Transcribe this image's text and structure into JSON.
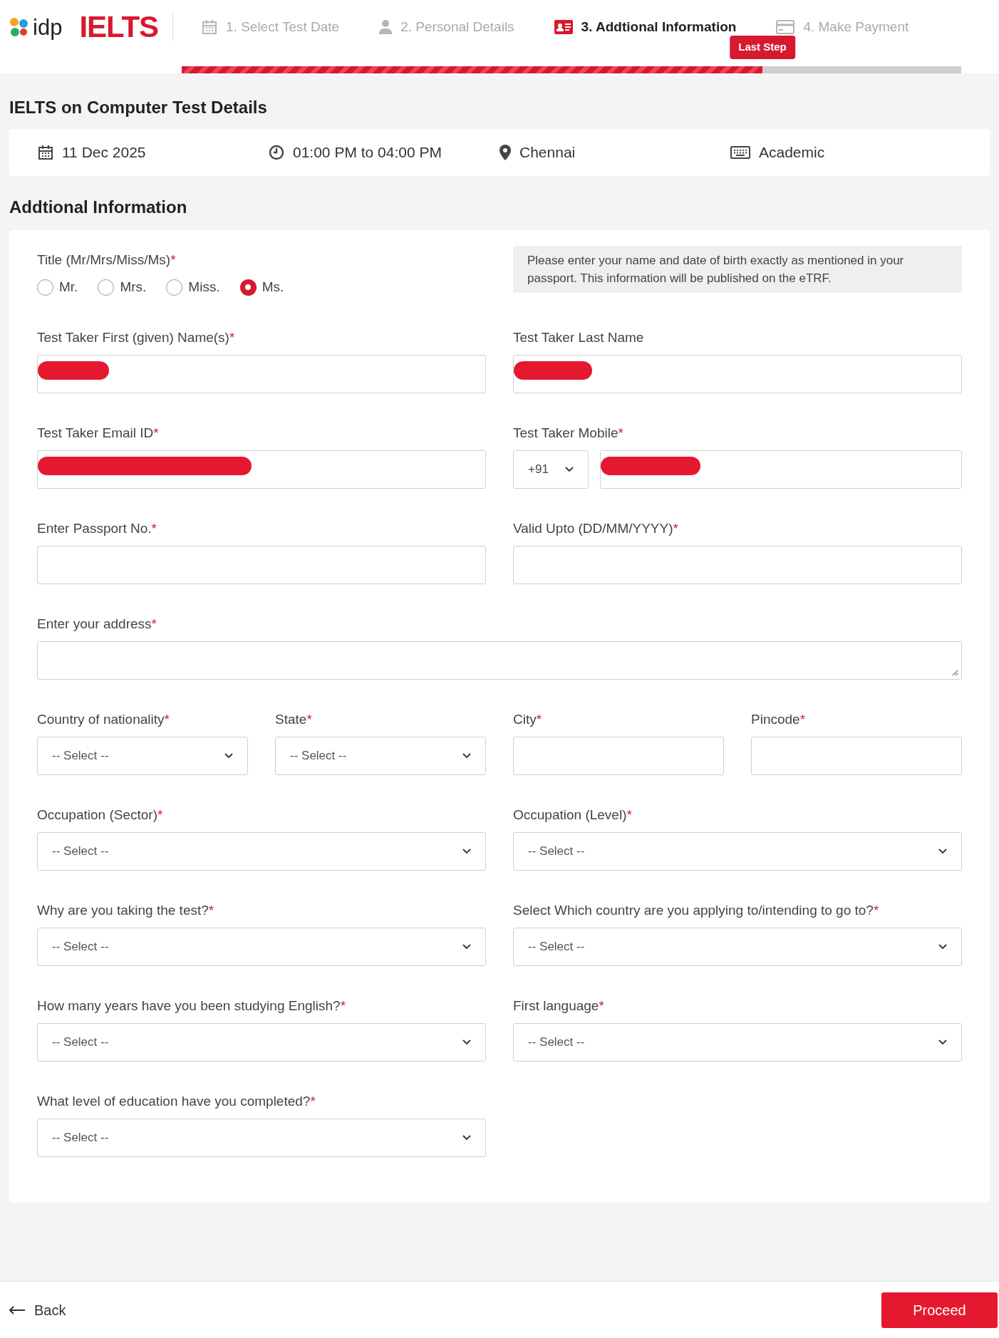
{
  "header": {
    "logo": "idp",
    "brand": "IELTS",
    "steps": [
      {
        "label": "1. Select Test Date",
        "kind": "calendar",
        "selected": false
      },
      {
        "label": "2. Personal Details",
        "kind": "person",
        "selected": false
      },
      {
        "label": "3. Addtional Information",
        "kind": "card",
        "selected": true
      },
      {
        "label": "4. Make Payment",
        "kind": "payment",
        "selected": false
      }
    ],
    "badge": "Last Step",
    "progress": {
      "level": 0.745
    }
  },
  "test_details": {
    "title": "IELTS on Computer Test Details",
    "items": [
      {
        "kind": "date",
        "text": "11 Dec 2025"
      },
      {
        "kind": "time",
        "text": "01:00 PM to 04:00 PM"
      },
      {
        "kind": "location",
        "text": "Chennai"
      },
      {
        "kind": "mode",
        "text": "Academic"
      }
    ]
  },
  "form": {
    "title": "Addtional Information",
    "title_field": {
      "label": "Title (Mr/Mrs/Miss/Ms)",
      "mark": "*",
      "options": [
        {
          "label": "Mr.",
          "selected": false
        },
        {
          "label": "Mrs.",
          "selected": false
        },
        {
          "label": "Miss.",
          "selected": false
        },
        {
          "label": "Ms.",
          "selected": true
        }
      ]
    },
    "notice": "Please enter your name and date of birth exactly as mentioned in your passport. This information will be published on the eTRF.",
    "rows": [
      {
        "fields": [
          {
            "kind": "text",
            "label": "Test Taker First (given) Name(s)",
            "mark": "*",
            "redacted": true
          },
          {
            "kind": "text",
            "label": "Test Taker Last Name",
            "redacted": true
          }
        ]
      },
      {
        "fields": [
          {
            "kind": "text",
            "label": "Test Taker Email ID",
            "mark": "*",
            "redacted": true
          },
          {
            "kind": "phone",
            "label": "Test Taker Mobile",
            "mark": "*",
            "code": "+91",
            "redacted": true
          }
        ]
      },
      {
        "fields": [
          {
            "kind": "text",
            "label": "Enter Passport No.",
            "mark": "*"
          },
          {
            "kind": "text",
            "label": "Valid Upto (DD/MM/YYYY)",
            "mark": "*"
          }
        ]
      },
      {
        "fields": [
          {
            "kind": "textarea",
            "label": "Enter your address",
            "mark": "*"
          }
        ]
      },
      {
        "fields": [
          {
            "kind": "select",
            "label": "Country of nationality",
            "mark": "*",
            "value": "-- Select --"
          },
          {
            "kind": "select",
            "label": "State",
            "mark": "*",
            "value": "-- Select --"
          },
          {
            "kind": "text",
            "label": "City",
            "mark": "*"
          },
          {
            "kind": "text",
            "label": "Pincode",
            "mark": "*"
          }
        ]
      },
      {
        "fields": [
          {
            "kind": "select",
            "label": "Occupation (Sector)",
            "mark": "*",
            "value": "-- Select --"
          },
          {
            "kind": "select",
            "label": "Occupation (Level)",
            "mark": "*",
            "value": "-- Select --"
          }
        ]
      },
      {
        "fields": [
          {
            "kind": "select",
            "label": "Why are you taking the test?",
            "mark": "*",
            "value": "-- Select --"
          },
          {
            "kind": "select",
            "label": "Select Which country are you applying to/intending to go to?",
            "mark": "*",
            "value": "-- Select --"
          }
        ]
      },
      {
        "fields": [
          {
            "kind": "select",
            "label": "How many years have you been studying English?",
            "mark": "*",
            "value": "-- Select --"
          },
          {
            "kind": "select",
            "label": "First language",
            "mark": "*",
            "value": "-- Select --"
          }
        ]
      },
      {
        "fields": [
          {
            "kind": "select",
            "label": "What level of education have you completed?",
            "mark": "*",
            "value": "-- Select --"
          }
        ]
      }
    ]
  },
  "footer": {
    "back": "Back",
    "proceed": "Proceed"
  }
}
